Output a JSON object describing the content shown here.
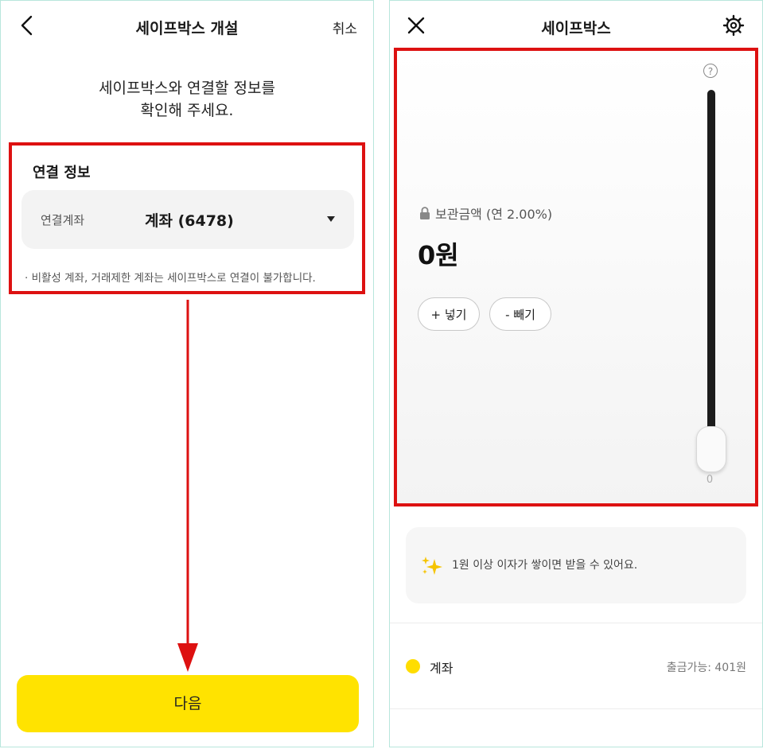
{
  "left": {
    "header": {
      "title": "세이프박스 개설",
      "cancel_label": "취소"
    },
    "headline": {
      "line1": "세이프박스와 연결할 정보를",
      "line2": "확인해 주세요."
    },
    "connection": {
      "title": "연결 정보",
      "account_label": "연결계좌",
      "account_value": "계좌 (6478)",
      "note": "· 비활성 계좌, 거래제한 계좌는 세이프박스로 연결이 불가합니다."
    },
    "next_label": "다음"
  },
  "right": {
    "header": {
      "title": "세이프박스"
    },
    "box": {
      "help_mark": "?",
      "stored_label": "보관금액 (연 2.00%)",
      "amount": "0원",
      "deposit_label": "+ 넣기",
      "withdraw_label": "- 빼기",
      "slider_min": "0",
      "slider_level": 0
    },
    "notice": "1원 이상 이자가 쌓이면 받을 수 있어요.",
    "account": {
      "name": "계좌",
      "available": "출금가능: 401원"
    }
  },
  "colors": {
    "accent_yellow": "#ffe300",
    "annotation_red": "#dd1111",
    "slider_track": "#1c1c1c"
  },
  "icons": [
    "back-icon",
    "close-icon",
    "gear-icon",
    "help-icon",
    "lock-icon",
    "sparkle-icon",
    "dropdown-icon"
  ]
}
